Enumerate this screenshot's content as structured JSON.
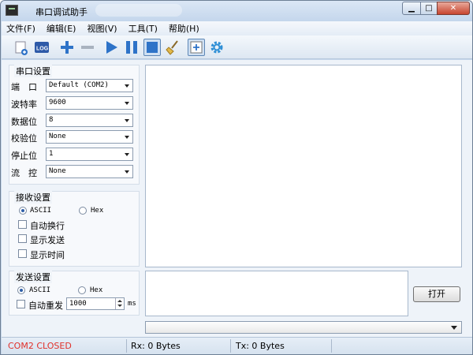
{
  "window": {
    "title": "串口调试助手"
  },
  "menu": [
    "文件(F)",
    "编辑(E)",
    "视图(V)",
    "工具(T)",
    "帮助(H)"
  ],
  "toolbar_icons": [
    "new-icon",
    "log-icon",
    "add-icon",
    "remove-icon",
    "play-icon",
    "pause-icon",
    "stop-icon",
    "broom-icon",
    "add-frame-icon",
    "settings-icon"
  ],
  "serial": {
    "title": "串口设置",
    "rows": [
      {
        "label": "端　口",
        "value": "Default (COM2)"
      },
      {
        "label": "波特率",
        "value": "9600"
      },
      {
        "label": "数据位",
        "value": "8"
      },
      {
        "label": "校验位",
        "value": "None"
      },
      {
        "label": "停止位",
        "value": "1"
      },
      {
        "label": "流　控",
        "value": "None"
      }
    ]
  },
  "receive": {
    "title": "接收设置",
    "ascii": "ASCII",
    "hex": "Hex",
    "auto_newline": "自动换行",
    "show_send": "显示发送",
    "show_time": "显示时间"
  },
  "send": {
    "title": "发送设置",
    "ascii": "ASCII",
    "hex": "Hex",
    "auto_resend": "自动重发",
    "interval": "1000",
    "unit": "ms"
  },
  "open_button": "打开",
  "status": {
    "port_state": "COM2 CLOSED",
    "rx": "Rx: 0 Bytes",
    "tx": "Tx: 0 Bytes"
  },
  "colors": {
    "status_closed": "#e0302a",
    "accent_blue": "#2e73c8"
  }
}
